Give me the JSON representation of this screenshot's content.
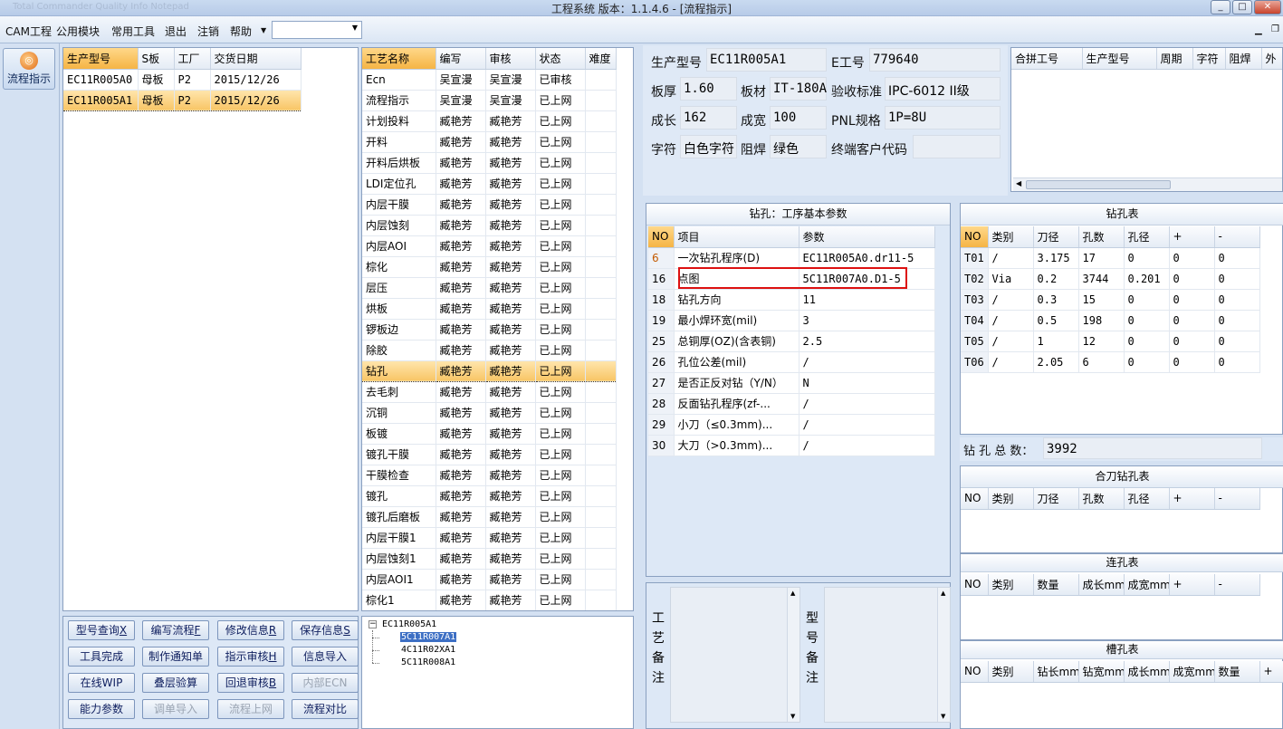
{
  "window": {
    "title": "工程系统   版本：1.1.4.6 - [流程指示]",
    "ghost_tabs": "Total Commander   Quality Info   Notepad"
  },
  "menu": {
    "items": [
      "CAM工程",
      "公用模块",
      "常用工具",
      "退出",
      "注销",
      "帮助"
    ],
    "combo_value": ""
  },
  "left_tool": {
    "flow_label": "流程指示"
  },
  "model_list": {
    "headers": [
      "生产型号",
      "S板",
      "工厂",
      "交货日期"
    ],
    "rows": [
      [
        "EC11R005A0",
        "母板",
        "P2",
        "2015/12/26"
      ],
      [
        "EC11R005A1",
        "母板",
        "P2",
        "2015/12/26"
      ]
    ]
  },
  "process_list": {
    "headers": [
      "工艺名称",
      "编写",
      "审核",
      "状态",
      "难度"
    ],
    "rows": [
      [
        "Ecn",
        "吴宣漫",
        "吴宣漫",
        "已审核",
        ""
      ],
      [
        "流程指示",
        "吴宣漫",
        "吴宣漫",
        "已上网",
        ""
      ],
      [
        "计划投料",
        "臧艳芳",
        "臧艳芳",
        "已上网",
        ""
      ],
      [
        "开料",
        "臧艳芳",
        "臧艳芳",
        "已上网",
        ""
      ],
      [
        "开料后烘板",
        "臧艳芳",
        "臧艳芳",
        "已上网",
        ""
      ],
      [
        "LDI定位孔",
        "臧艳芳",
        "臧艳芳",
        "已上网",
        ""
      ],
      [
        "内层干膜",
        "臧艳芳",
        "臧艳芳",
        "已上网",
        ""
      ],
      [
        "内层蚀刻",
        "臧艳芳",
        "臧艳芳",
        "已上网",
        ""
      ],
      [
        "内层AOI",
        "臧艳芳",
        "臧艳芳",
        "已上网",
        ""
      ],
      [
        "棕化",
        "臧艳芳",
        "臧艳芳",
        "已上网",
        ""
      ],
      [
        "层压",
        "臧艳芳",
        "臧艳芳",
        "已上网",
        ""
      ],
      [
        "烘板",
        "臧艳芳",
        "臧艳芳",
        "已上网",
        ""
      ],
      [
        "锣板边",
        "臧艳芳",
        "臧艳芳",
        "已上网",
        ""
      ],
      [
        "除胶",
        "臧艳芳",
        "臧艳芳",
        "已上网",
        ""
      ],
      [
        "钻孔",
        "臧艳芳",
        "臧艳芳",
        "已上网",
        ""
      ],
      [
        "去毛刺",
        "臧艳芳",
        "臧艳芳",
        "已上网",
        ""
      ],
      [
        "沉铜",
        "臧艳芳",
        "臧艳芳",
        "已上网",
        ""
      ],
      [
        "板镀",
        "臧艳芳",
        "臧艳芳",
        "已上网",
        ""
      ],
      [
        "镀孔干膜",
        "臧艳芳",
        "臧艳芳",
        "已上网",
        ""
      ],
      [
        "干膜检查",
        "臧艳芳",
        "臧艳芳",
        "已上网",
        ""
      ],
      [
        "镀孔",
        "臧艳芳",
        "臧艳芳",
        "已上网",
        ""
      ],
      [
        "镀孔后磨板",
        "臧艳芳",
        "臧艳芳",
        "已上网",
        ""
      ],
      [
        "内层干膜1",
        "臧艳芳",
        "臧艳芳",
        "已上网",
        ""
      ],
      [
        "内层蚀刻1",
        "臧艳芳",
        "臧艳芳",
        "已上网",
        ""
      ],
      [
        "内层AOI1",
        "臧艳芳",
        "臧艳芳",
        "已上网",
        ""
      ],
      [
        "棕化1",
        "臧艳芳",
        "臧艳芳",
        "已上网",
        ""
      ]
    ]
  },
  "buttons": [
    [
      "型号查询",
      "X",
      false
    ],
    [
      "编写流程",
      "F",
      false
    ],
    [
      "修改信息",
      "R",
      false
    ],
    [
      "保存信息",
      "S",
      false
    ],
    [
      "工具完成",
      "",
      false
    ],
    [
      "制作通知单",
      "",
      false
    ],
    [
      "指示审核",
      "H",
      false
    ],
    [
      "信息导入",
      "",
      false
    ],
    [
      "在线WIP",
      "",
      false
    ],
    [
      "叠层验算",
      "",
      false
    ],
    [
      "回退审核",
      "B",
      false
    ],
    [
      "内部ECN",
      "",
      true
    ],
    [
      "能力参数",
      "",
      false
    ],
    [
      "调单导入",
      "",
      true
    ],
    [
      "流程上网",
      "",
      true
    ],
    [
      "流程对比",
      "",
      false
    ]
  ],
  "tree": {
    "root": "EC11R005A1",
    "children": [
      "5C11R007A1",
      "4C11R02XA1",
      "5C11R008A1"
    ]
  },
  "info": {
    "model_label": "生产型号",
    "model": "EC11R005A1",
    "e_label": "E工号",
    "e_no": "779640",
    "thick_label": "板厚",
    "thick": "1.60",
    "mat_label": "板材",
    "mat": "IT-180A",
    "std_label": "验收标准",
    "std": "IPC-6012 II级",
    "len_label": "成长",
    "len": "162",
    "wid_label": "成宽",
    "wid": "100",
    "pnl_label": "PNL规格",
    "pnl": "1P=8U",
    "char_label": "字符",
    "char": "白色字符",
    "mask_label": "阻焊",
    "mask": "绿色",
    "cust_label": "终端客户代码",
    "cust": ""
  },
  "merge_table": {
    "headers": [
      "合拼工号",
      "生产型号",
      "周期",
      "字符",
      "阻焊",
      "外"
    ]
  },
  "drill_params": {
    "title": "钻孔：工序基本参数",
    "headers": [
      "NO",
      "项目",
      "参数"
    ],
    "rows": [
      [
        "6",
        "一次钻孔程序(D)",
        "EC11R005A0.dr11-5"
      ],
      [
        "16",
        "点图",
        "5C11R007A0.D1-5"
      ],
      [
        "18",
        "钻孔方向",
        "11"
      ],
      [
        "19",
        "最小焊环宽(mil)",
        "3"
      ],
      [
        "25",
        "总铜厚(OZ)(含表铜)",
        "2.5"
      ],
      [
        "26",
        "孔位公差(mil)",
        "/"
      ],
      [
        "27",
        "是否正反对钻（Y/N）",
        "N"
      ],
      [
        "28",
        "反面钻孔程序(zf-...",
        "/"
      ],
      [
        "29",
        "小刀（≤0.3mm)...",
        "/"
      ],
      [
        "30",
        "大刀（>0.3mm)...",
        "/"
      ]
    ]
  },
  "drill_table": {
    "title": "钻孔表",
    "headers": [
      "NO",
      "类别",
      "刀径",
      "孔数",
      "孔径",
      "+",
      "-"
    ],
    "rows": [
      [
        "T01",
        "/",
        "3.175",
        "17",
        "0",
        "0",
        "0"
      ],
      [
        "T02",
        "Via",
        "0.2",
        "3744",
        "0.201",
        "0",
        "0"
      ],
      [
        "T03",
        "/",
        "0.3",
        "15",
        "0",
        "0",
        "0"
      ],
      [
        "T04",
        "/",
        "0.5",
        "198",
        "0",
        "0",
        "0"
      ],
      [
        "T05",
        "/",
        "1",
        "12",
        "0",
        "0",
        "0"
      ],
      [
        "T06",
        "/",
        "2.05",
        "6",
        "0",
        "0",
        "0"
      ]
    ]
  },
  "total": {
    "label": "钻 孔 总 数：",
    "value": "3992"
  },
  "combo_drill": {
    "title": "合刀钻孔表",
    "headers": [
      "NO",
      "类别",
      "刀径",
      "孔数",
      "孔径",
      "+",
      "-"
    ]
  },
  "link_hole": {
    "title": "连孔表",
    "headers": [
      "NO",
      "类别",
      "数量",
      "成长mm",
      "成宽mm",
      "+",
      "-"
    ]
  },
  "slot_hole": {
    "title": "槽孔表",
    "headers": [
      "NO",
      "类别",
      "钻长mm",
      "钻宽mm",
      "成长mm",
      "成宽mm",
      "数量",
      "+"
    ]
  },
  "notes": {
    "process_label": "工艺备注",
    "model_label": "型号备注"
  }
}
